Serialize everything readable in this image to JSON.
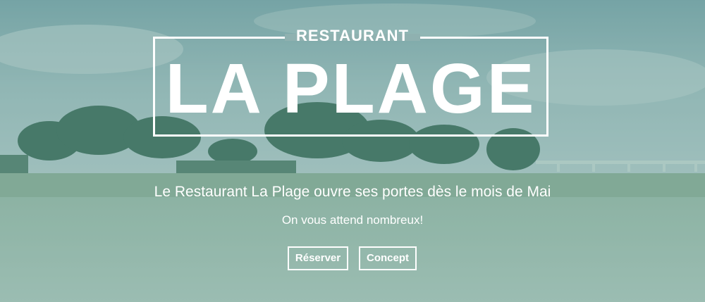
{
  "logo": {
    "top_text": "RESTAURANT",
    "main_text": "LA PLAGE"
  },
  "hero": {
    "tagline": "Le Restaurant La Plage ouvre ses portes dès le mois de Mai",
    "subtitle": "On vous attend nombreux!"
  },
  "buttons": {
    "reserve": "Réserver",
    "concept": "Concept"
  },
  "colors": {
    "sky": "#8fb4b4",
    "trees": "#3f6b58",
    "sand": "#a9c3b5",
    "overlay": "#5c9e96",
    "text": "#ffffff"
  }
}
